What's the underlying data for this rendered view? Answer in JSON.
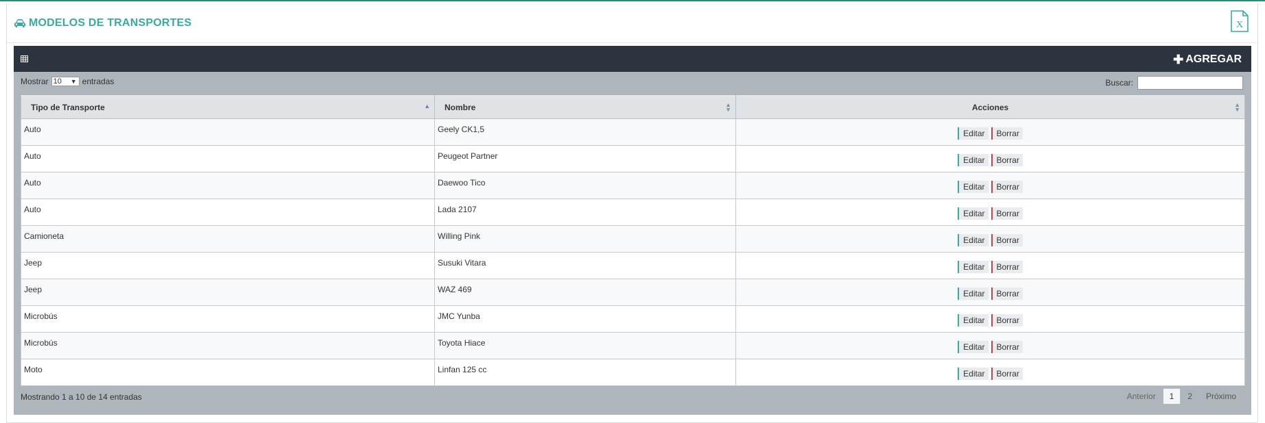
{
  "header": {
    "title": "MODELOS DE TRANSPORTES",
    "title_icon": "car-icon",
    "export_icon": "excel-export-icon",
    "export_icon_letter": "X"
  },
  "toolbar": {
    "grid_icon": "table-icon",
    "add_label": "AGREGAR",
    "add_icon": "plus-icon"
  },
  "controls": {
    "show_label": "Mostrar",
    "page_length": "10",
    "entries_label": "entradas",
    "search_label": "Buscar:",
    "search_value": ""
  },
  "table": {
    "columns": [
      "Tipo de Transporte",
      "Nombre",
      "Acciones"
    ],
    "edit_label": "Editar",
    "delete_label": "Borrar",
    "rows": [
      {
        "tipo": "Auto",
        "nombre": "Geely CK1,5"
      },
      {
        "tipo": "Auto",
        "nombre": "Peugeot Partner"
      },
      {
        "tipo": "Auto",
        "nombre": "Daewoo Tico"
      },
      {
        "tipo": "Auto",
        "nombre": "Lada 2107"
      },
      {
        "tipo": "Camioneta",
        "nombre": "Willing Pink"
      },
      {
        "tipo": "Jeep",
        "nombre": "Susuki Vitara"
      },
      {
        "tipo": "Jeep",
        "nombre": "WAZ 469"
      },
      {
        "tipo": "Microbús",
        "nombre": "JMC Yunba"
      },
      {
        "tipo": "Microbús",
        "nombre": "Toyota Hiace"
      },
      {
        "tipo": "Moto",
        "nombre": "Linfan 125 cc"
      }
    ]
  },
  "footer": {
    "info": "Mostrando 1 a 10 de 14 entradas",
    "prev": "Anterior",
    "pages": [
      "1",
      "2"
    ],
    "current_page": "1",
    "next": "Próximo"
  },
  "colors": {
    "accent": "#3aa9a0",
    "toolbar_bg": "#2c3440",
    "panel_bg": "#aeb6bc",
    "delete_accent": "#c0454a"
  }
}
